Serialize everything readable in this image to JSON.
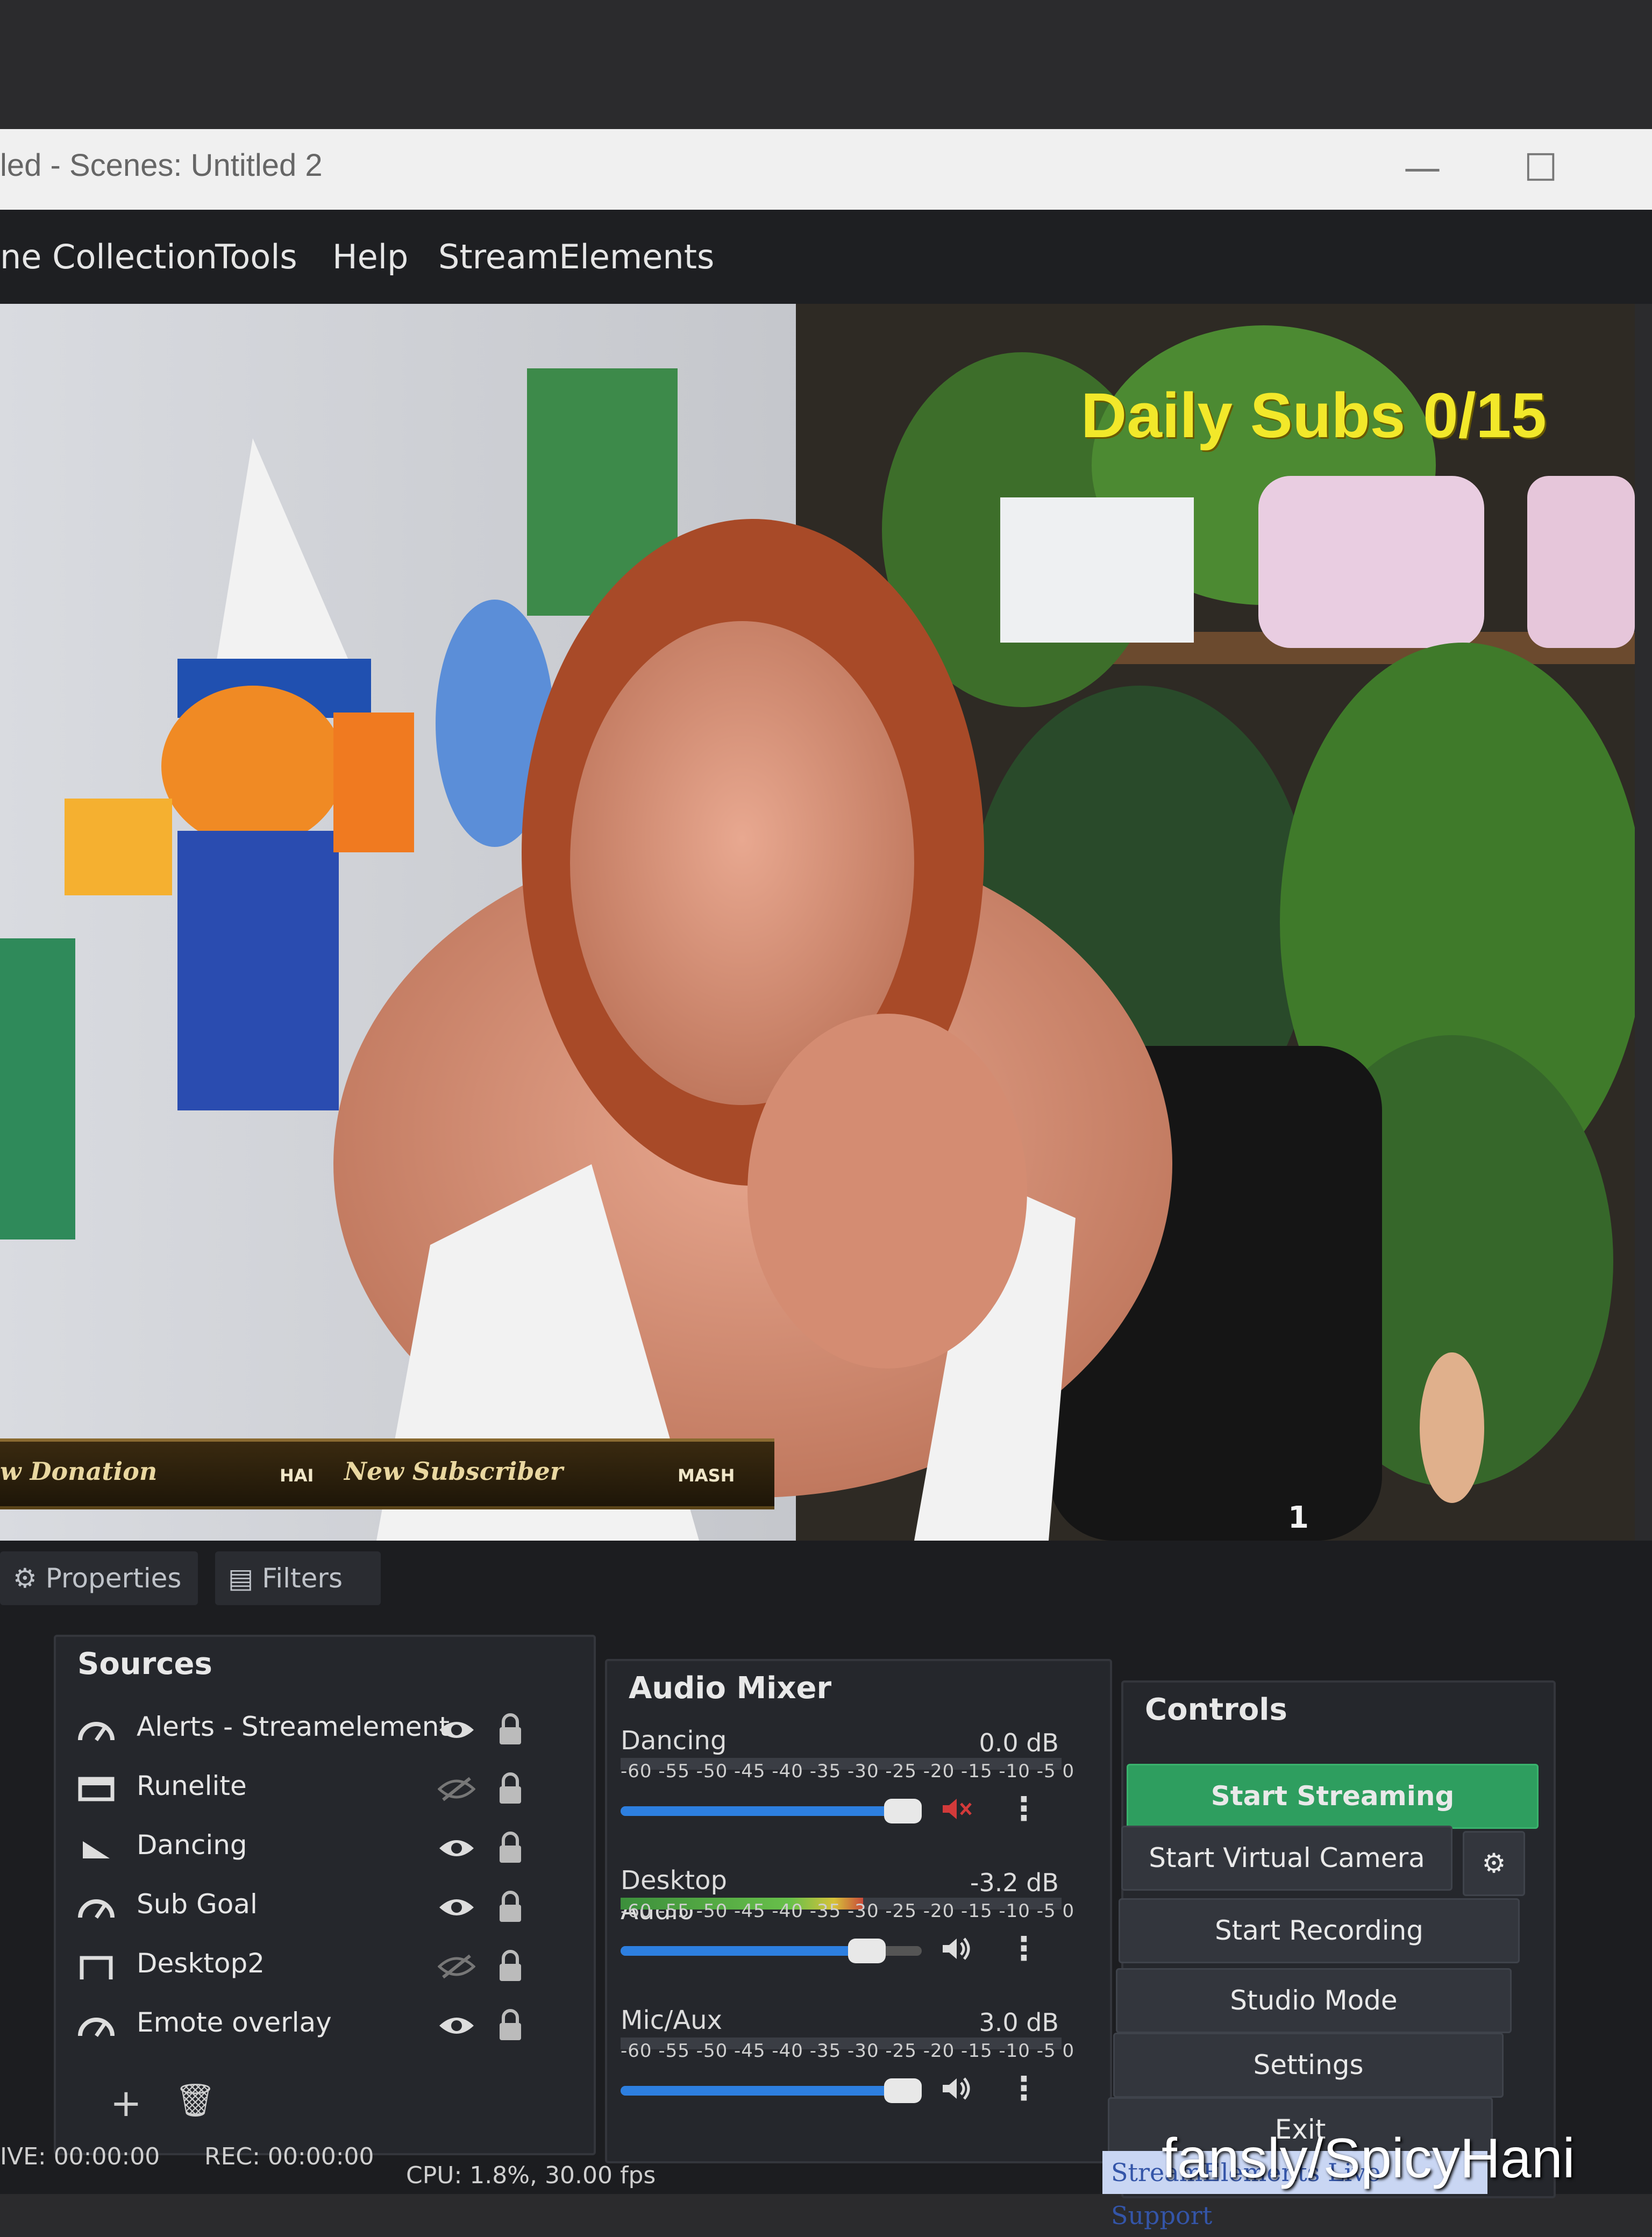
{
  "window": {
    "title": "led - Scenes: Untitled 2",
    "minimize_glyph": "—",
    "maximize_glyph": "☐"
  },
  "menu": [
    "ne Collection",
    "Tools",
    "Help",
    "StreamElements"
  ],
  "preview": {
    "sub_goal_text": "Daily Subs 0/15",
    "banner_items": [
      {
        "text": "w Donation",
        "tag": "HAI"
      },
      {
        "text": "New Subscriber",
        "tag": "MASH"
      }
    ],
    "corner_number": "1"
  },
  "tabs": {
    "properties": "Properties",
    "filters": "Filters"
  },
  "sources": {
    "title": "Sources",
    "items": [
      {
        "label": "Alerts - Streamelement",
        "icon": "gauge-icon",
        "visible": true
      },
      {
        "label": "Runelite",
        "icon": "window-capture-icon",
        "visible": false
      },
      {
        "label": "Dancing",
        "icon": "media-icon",
        "visible": true
      },
      {
        "label": "Sub Goal",
        "icon": "gauge-icon",
        "visible": true
      },
      {
        "label": "Desktop2",
        "icon": "display-capture-icon",
        "visible": false
      },
      {
        "label": "Emote overlay",
        "icon": "gauge-icon",
        "visible": true
      }
    ],
    "add_glyph": "+",
    "remove_glyph": "🗑"
  },
  "audio_mixer": {
    "title": "Audio Mixer",
    "scale": "-60 -55 -50 -45 -40 -35 -30 -25 -20 -15 -10 -5 0",
    "channels": [
      {
        "name": "Dancing",
        "db": "0.0 dB",
        "meter": 0.0,
        "volume": 1.0,
        "muted": true
      },
      {
        "name": "Desktop Audio",
        "db": "-3.2 dB",
        "meter": 0.55,
        "volume": 0.88,
        "muted": false
      },
      {
        "name": "Mic/Aux",
        "db": "3.0 dB",
        "meter": 0.0,
        "volume": 1.0,
        "muted": false
      }
    ]
  },
  "controls": {
    "title": "Controls",
    "start_streaming": "Start Streaming",
    "start_virtual_camera": "Start Virtual Camera",
    "start_recording": "Start Recording",
    "studio_mode": "Studio Mode",
    "settings": "Settings",
    "exit": "Exit"
  },
  "status": {
    "live": "IVE: 00:00:00",
    "rec": "REC: 00:00:00",
    "cpu": "CPU: 1.8%, 30.00 fps"
  },
  "streamelements_support": "StreamElements Live Support",
  "watermark": "fansly/SpicyHani",
  "colors": {
    "accent_green": "#2e9e5f",
    "sub_goal_yellow": "#f2e82a",
    "slider_blue": "#2d7fe0",
    "mute_red": "#d33a3a"
  }
}
